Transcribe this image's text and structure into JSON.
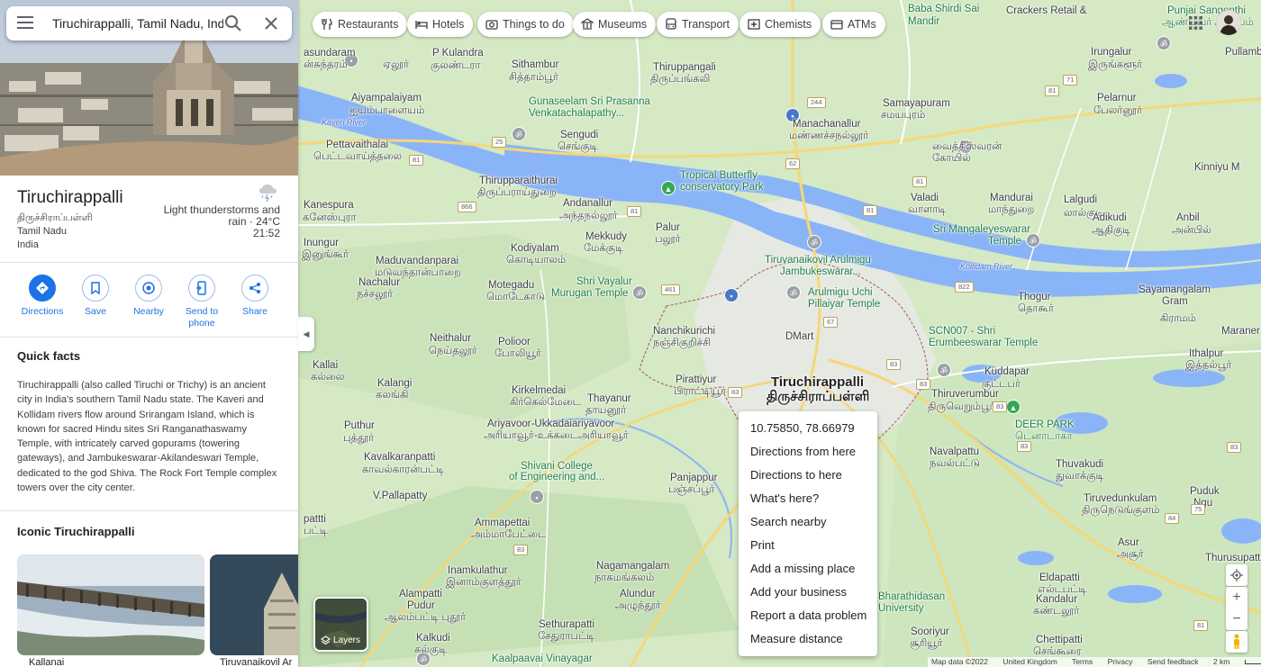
{
  "search": {
    "query": "Tiruchirappalli, Tamil Nadu, India"
  },
  "place": {
    "name": "Tiruchirappalli",
    "name_local": "திருச்சிராப்பள்ளி",
    "state": "Tamil Nadu",
    "country": "India",
    "weather_text": "Light thunderstorms and rain · 24°C",
    "weather_time": "21:52"
  },
  "actions": [
    {
      "label": "Directions"
    },
    {
      "label": "Save"
    },
    {
      "label": "Nearby"
    },
    {
      "label": "Send to phone"
    },
    {
      "label": "Share"
    }
  ],
  "quick_facts": {
    "title": "Quick facts",
    "text": "Tiruchirappalli (also called Tiruchi or Trichy) is an ancient city in India's southern Tamil Nadu state. The Kaveri and Kollidam rivers flow around Srirangam Island, which is known for sacred Hindu sites Sri Ranganathaswamy Temple, with intricately carved gopurams (towering gateways), and Jambukeswarar-Akilandeswari Temple, dedicated to the god Shiva. The Rock Fort Temple complex towers over the city center."
  },
  "iconic": {
    "title": "Iconic Tiruchirappalli",
    "cards": [
      {
        "label": "Kallanai"
      },
      {
        "label": "Tiruvanaikovil Ar"
      }
    ]
  },
  "chips": [
    {
      "label": "Restaurants",
      "icon": "fork-knife-icon"
    },
    {
      "label": "Hotels",
      "icon": "bed-icon"
    },
    {
      "label": "Things to do",
      "icon": "camera-icon"
    },
    {
      "label": "Museums",
      "icon": "museum-icon"
    },
    {
      "label": "Transport",
      "icon": "bus-icon"
    },
    {
      "label": "Chemists",
      "icon": "pharmacy-icon"
    },
    {
      "label": "ATMs",
      "icon": "atm-icon"
    }
  ],
  "context_menu": [
    "10.75850, 78.66979",
    "Directions from here",
    "Directions to here",
    "What's here?",
    "Search nearby",
    "Print",
    "Add a missing place",
    "Add your business",
    "Report a data problem",
    "Measure distance"
  ],
  "layers_label": "Layers",
  "footer": {
    "map_data": "Map data ©2022",
    "region": "United Kingdom",
    "terms": "Terms",
    "privacy": "Privacy",
    "feedback": "Send feedback",
    "scale": "2 km"
  },
  "map_labels": [
    {
      "id": "ellur",
      "text": "ஏலூர்"
    },
    {
      "id": "pkulandra",
      "text": "P Kulandra"
    },
    {
      "id": "pkulandra-ta",
      "text": "குலண்டரா"
    },
    {
      "id": "sithambur",
      "text": "Sithambur"
    },
    {
      "id": "sithambur-ta",
      "text": "சித்தாம்பூர்"
    },
    {
      "id": "thiruppangali",
      "text": "Thiruppangali"
    },
    {
      "id": "thiruppangali-ta",
      "text": "திருப்பங்கலி"
    },
    {
      "id": "baba",
      "text": "Baba Shirdi Sai"
    },
    {
      "id": "baba2",
      "text": "Mandir"
    },
    {
      "id": "sengudi",
      "text": "Sengudi"
    },
    {
      "id": "sengudi-ta",
      "text": "செங்குடி"
    },
    {
      "id": "aiyampalayam",
      "text": "Aiyampalaiyam"
    },
    {
      "id": "aiyampalayam-ta",
      "text": "ஐயம்பாளையம்"
    },
    {
      "id": "gunaseelam",
      "text": "Gunaseelam Sri Prasanna"
    },
    {
      "id": "gunaseelam2",
      "text": "Venkatachalapathy..."
    },
    {
      "id": "manachanallur",
      "text": "Manachanallur"
    },
    {
      "id": "manachanallur-ta",
      "text": "மண்ணச்சநல்லூர்"
    },
    {
      "id": "samayapuram",
      "text": "Samayapuram"
    },
    {
      "id": "samayapuram-ta",
      "text": "சமயபுரம்"
    },
    {
      "id": "irungalur",
      "text": "Irungalur"
    },
    {
      "id": "irungalur-ta",
      "text": "இருங்களூர்"
    },
    {
      "id": "pullambadi",
      "text": "Pullamb"
    },
    {
      "id": "pettavaithalai",
      "text": "Pettavaithalai"
    },
    {
      "id": "pettavaithalai-ta",
      "text": "பெட்டவாய்த்தலை"
    },
    {
      "id": "thirupparaithurai",
      "text": "Thirupparaithurai"
    },
    {
      "id": "thirupparaithurai-ta",
      "text": "திருப்பராய்துறை"
    },
    {
      "id": "butterfly",
      "text": "Tropical Butterfly"
    },
    {
      "id": "butterfly2",
      "text": "conservatory Park"
    },
    {
      "id": "pelarnur",
      "text": "Pelarnur"
    },
    {
      "id": "pelarnur-ta",
      "text": "பேலர்னூர்"
    },
    {
      "id": "vaitheeswaran",
      "text": "வைத்தீஸ்வரன்"
    },
    {
      "id": "kovil",
      "text": "கோயில்"
    },
    {
      "id": "kanespura",
      "text": "Kanespura"
    },
    {
      "id": "kanespura-ta",
      "text": "கனேஸ்புரா"
    },
    {
      "id": "andanallur",
      "text": "Andanallur"
    },
    {
      "id": "andanallur-ta",
      "text": "அந்தநல்லூர்"
    },
    {
      "id": "palur",
      "text": "Palur"
    },
    {
      "id": "palur-ta",
      "text": "பலூர்"
    },
    {
      "id": "valadi",
      "text": "Valadi"
    },
    {
      "id": "valadi-ta",
      "text": "வாளாடி"
    },
    {
      "id": "mandurai",
      "text": "Mandurai"
    },
    {
      "id": "mandurai-ta",
      "text": "மாந்துறை"
    },
    {
      "id": "lalgudi",
      "text": "Lalgudi"
    },
    {
      "id": "lalgudi-ta",
      "text": "லால்குடி"
    },
    {
      "id": "kinniyu",
      "text": "Kinniyu M"
    },
    {
      "id": "inungur",
      "text": "Inungur"
    },
    {
      "id": "inungur-ta",
      "text": "இனுங்கூர்"
    },
    {
      "id": "kodiyalam",
      "text": "Kodiyalam"
    },
    {
      "id": "kodiyalam-ta",
      "text": "கொடியாலம்"
    },
    {
      "id": "mekkudy",
      "text": "Mekkudy"
    },
    {
      "id": "mekkudy-ta",
      "text": "மேக்குடி"
    },
    {
      "id": "srirangam-temple",
      "text": "Sri Mangaleyeswarar"
    },
    {
      "id": "srirangam-temple2",
      "text": "Temple"
    },
    {
      "id": "adikudi",
      "text": "Adikudi"
    },
    {
      "id": "adikudi-ta",
      "text": "ஆதிகுடி"
    },
    {
      "id": "anbil",
      "text": "Anbil"
    },
    {
      "id": "anbil-ta",
      "text": "அன்பில்"
    },
    {
      "id": "maduvandanpara",
      "text": "Maduvandanparai"
    },
    {
      "id": "maduvandanpara-ta",
      "text": "மடுவந்தான்பாறை"
    },
    {
      "id": "nachalur",
      "text": "Nachalur"
    },
    {
      "id": "nachalur-ta",
      "text": "நச்சலூர்"
    },
    {
      "id": "motegadu",
      "text": "Motegadu"
    },
    {
      "id": "motegadu-ta",
      "text": "மொடேகாடு"
    },
    {
      "id": "shrivayalur",
      "text": "Shri Vayalur"
    },
    {
      "id": "shrivayalur2",
      "text": "Murugan Temple"
    },
    {
      "id": "tiruvanaikovil",
      "text": "Tiruvanaikovil Arulmigu"
    },
    {
      "id": "tiruvanaikovil2",
      "text": "Jambukeswarar..."
    },
    {
      "id": "uchi",
      "text": "Arulmigu Uchi"
    },
    {
      "id": "uchi2",
      "text": "Pillaiyar Temple"
    },
    {
      "id": "thogur",
      "text": "Thogur"
    },
    {
      "id": "thogur-ta",
      "text": "தொகூர்"
    },
    {
      "id": "sayamangalam",
      "text": "Sayamangalam"
    },
    {
      "id": "sayamangalam2",
      "text": "Gram"
    },
    {
      "id": "sayamangalam-ta",
      "text": "கிராமம்"
    },
    {
      "id": "neithalur",
      "text": "Neithalur"
    },
    {
      "id": "neithalur-ta",
      "text": "நெய்தலூர்"
    },
    {
      "id": "nanchikurichi",
      "text": "Nanchikurichi"
    },
    {
      "id": "nanchikurichi-ta",
      "text": "நஞ்சிகுறிச்சி"
    },
    {
      "id": "dmart",
      "text": "DMart"
    },
    {
      "id": "scn",
      "text": "SCN007 - Shri"
    },
    {
      "id": "scn2",
      "text": "Erumbeeswarar Temple"
    },
    {
      "id": "maraner",
      "text": "Maraner"
    },
    {
      "id": "polioor",
      "text": "Polioor"
    },
    {
      "id": "polioor-ta",
      "text": "போலியூர்"
    },
    {
      "id": "ithalpur",
      "text": "Ithalpur"
    },
    {
      "id": "ithalpur-ta",
      "text": "இத்தல்பூர்"
    },
    {
      "id": "kallai",
      "text": "Kallai"
    },
    {
      "id": "kallai-ta",
      "text": "கல்லை"
    },
    {
      "id": "kalangi",
      "text": "Kalangi"
    },
    {
      "id": "kalangi-ta",
      "text": "கலங்கி"
    },
    {
      "id": "kirkelmedai",
      "text": "Kirkelmedai"
    },
    {
      "id": "kirkelmedai-ta",
      "text": "கிர்கெல்மேடை"
    },
    {
      "id": "pirattiyur",
      "text": "Pirattiyur"
    },
    {
      "id": "pirattiyur-ta",
      "text": "பிராட்டியூர்"
    },
    {
      "id": "trichy",
      "text": "Tiruchirappalli"
    },
    {
      "id": "trichy-ta",
      "text": "திருச்சிராப்பள்ளி"
    },
    {
      "id": "kuddapar",
      "text": "Kuddapar"
    },
    {
      "id": "kuddapar-ta",
      "text": "குட்டபர்"
    },
    {
      "id": "thiruverumbur",
      "text": "Thiruverumbur"
    },
    {
      "id": "thiruverumbur-ta",
      "text": "திருவெறும்பூர்"
    },
    {
      "id": "thayanur",
      "text": "Thayanur"
    },
    {
      "id": "thayanur-ta",
      "text": "தாயனூர்"
    },
    {
      "id": "ariyavoor",
      "text": "Ariyavoor-Ukkadaiariyavoor"
    },
    {
      "id": "ariyavoor-ta",
      "text": "அரியாவூர்-உக்கடைஅரியாவூர்"
    },
    {
      "id": "puthur",
      "text": "Puthur"
    },
    {
      "id": "puthur-ta",
      "text": "புத்தூர்"
    },
    {
      "id": "deerpark",
      "text": "DEER PARK"
    },
    {
      "id": "deerpark-ta",
      "text": "டெனாடாகா"
    },
    {
      "id": "navalpattu",
      "text": "Navalpattu"
    },
    {
      "id": "navalpattu-ta",
      "text": "நவல்பட்டு"
    },
    {
      "id": "kavalkaranpatti",
      "text": "Kavalkaranpatti"
    },
    {
      "id": "kavalkaranpatti-ta",
      "text": "காவல்காரன்பட்டி"
    },
    {
      "id": "shivani",
      "text": "Shivani College"
    },
    {
      "id": "shivani2",
      "text": "of Engineering and..."
    },
    {
      "id": "panjappur",
      "text": "Panjappur"
    },
    {
      "id": "panjappur-ta",
      "text": "பஞ்சப்பூர்"
    },
    {
      "id": "thuvakudi",
      "text": "Thuvakudi"
    },
    {
      "id": "thuvakudi-ta",
      "text": "துவாக்குடி"
    },
    {
      "id": "vpallapatty",
      "text": "V.Pallapatty"
    },
    {
      "id": "pattiw",
      "text": "pattti"
    },
    {
      "id": "pattiw-ta",
      "text": "பட்டி"
    },
    {
      "id": "ammapettai",
      "text": "Ammapettai"
    },
    {
      "id": "ammapettai-ta",
      "text": "அம்மாபேட்டை"
    },
    {
      "id": "tiruvedunkulam",
      "text": "Tiruvedunkulam"
    },
    {
      "id": "tiruvedunkulam-ta",
      "text": "திருநெடுங்குளம்"
    },
    {
      "id": "pudukudi",
      "text": "Puduk"
    },
    {
      "id": "pudukudi2",
      "text": "Ngu"
    },
    {
      "id": "asur",
      "text": "Asur"
    },
    {
      "id": "asur-ta",
      "text": "அசூர்"
    },
    {
      "id": "thurusupatti",
      "text": "Thurusupatti"
    },
    {
      "id": "inamkulathur",
      "text": "Inamkulathur"
    },
    {
      "id": "inamkulathur-ta",
      "text": "இனாம்குளத்தூர்"
    },
    {
      "id": "nagamangalam",
      "text": "Nagamangalam"
    },
    {
      "id": "nagamangalam-ta",
      "text": "நாகமங்கலம்"
    },
    {
      "id": "bharathidasan",
      "text": "Bharathidasan"
    },
    {
      "id": "bharathidasan2",
      "text": "University"
    },
    {
      "id": "eldapatti",
      "text": "Eldapatti"
    },
    {
      "id": "eldapatti-ta",
      "text": "எல்டபட்டி"
    },
    {
      "id": "kandalur",
      "text": "Kandalur"
    },
    {
      "id": "kandalur-ta",
      "text": "கண்டலூர்"
    },
    {
      "id": "alampatti",
      "text": "Alampatti"
    },
    {
      "id": "alampatti2",
      "text": "Pudur"
    },
    {
      "id": "alampatti-ta",
      "text": "ஆலம்பட்டி புதூர்"
    },
    {
      "id": "alundur",
      "text": "Alundur"
    },
    {
      "id": "alundur-ta",
      "text": "அழுந்தூர்"
    },
    {
      "id": "sethurapatti",
      "text": "Sethurapatti"
    },
    {
      "id": "sethurapatti-ta",
      "text": "சேதுராபட்டி"
    },
    {
      "id": "sooriyur",
      "text": "Sooriyur"
    },
    {
      "id": "sooriyur-ta",
      "text": "சூரியூர்"
    },
    {
      "id": "chettipatti",
      "text": "Chettipatti"
    },
    {
      "id": "chettipatti-ta",
      "text": "செங்கூரை"
    },
    {
      "id": "kalkudi",
      "text": "Kalkudi"
    },
    {
      "id": "kalkudi-ta",
      "text": "கல்குடி"
    },
    {
      "id": "vinayagar",
      "text": "Kaalpaavai Vinayagar"
    },
    {
      "id": "crackers",
      "text": "Crackers Retail &"
    },
    {
      "id": "punjai",
      "text": "Punjai Sangenthi"
    },
    {
      "id": "punjai-ta",
      "text": "ஆண்டவர் ஆலயம்"
    },
    {
      "id": "kaveri-river",
      "text": "Kaveri River"
    },
    {
      "id": "kollidam-river",
      "text": "Kollidam River"
    },
    {
      "id": "sasundarar",
      "text": "asundaram"
    },
    {
      "id": "sasundarar2",
      "text": "ன்சுந்தரம்"
    }
  ],
  "road_shields": [
    "25",
    "81",
    "866",
    "81",
    "461",
    "62",
    "81",
    "244",
    "81",
    "822",
    "83",
    "83",
    "83",
    "67",
    "83",
    "83",
    "83",
    "81",
    "71",
    "84",
    "75",
    "83",
    "81"
  ],
  "colors": {
    "accent": "#1a73e8",
    "water": "#8ab4f8",
    "park": "#c8e6c9",
    "urban": "#e8eae6",
    "land": "#d6ebc8"
  }
}
